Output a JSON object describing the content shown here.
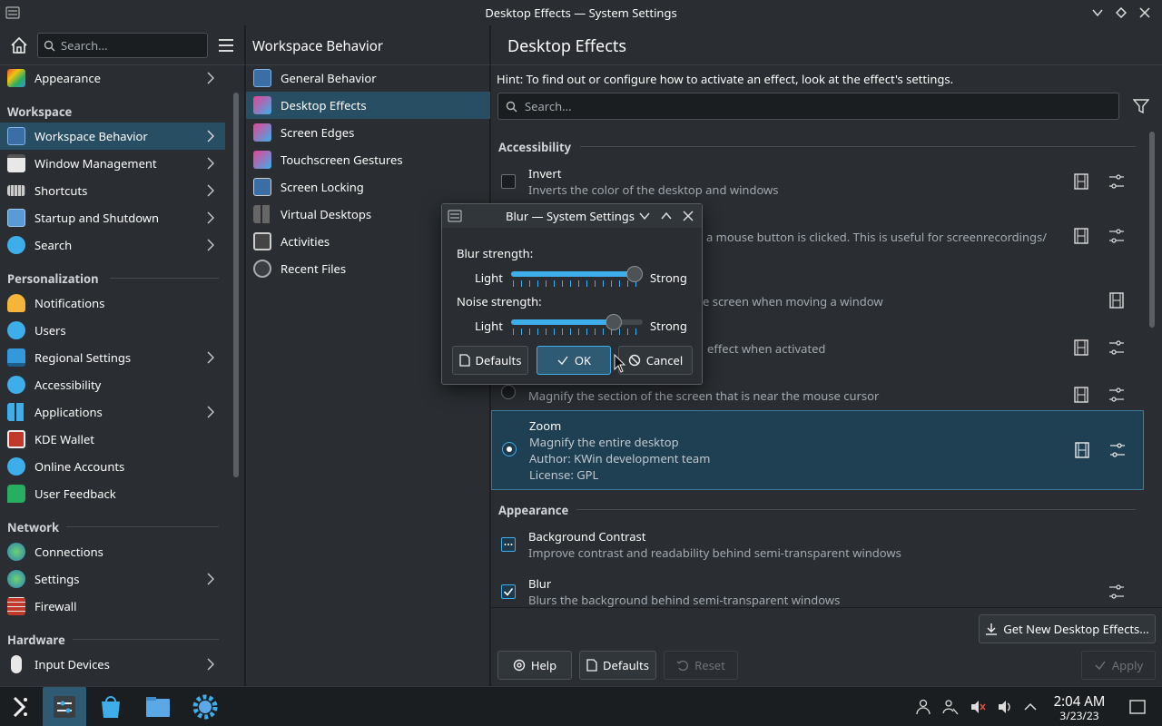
{
  "window": {
    "title": "Desktop Effects — System Settings"
  },
  "sidebar": {
    "search_placeholder": "Search...",
    "top_item": {
      "label": "Appearance"
    },
    "sections": [
      {
        "header": "Workspace",
        "items": [
          "Workspace Behavior",
          "Window Management",
          "Shortcuts",
          "Startup and Shutdown",
          "Search"
        ]
      },
      {
        "header": "Personalization",
        "items": [
          "Notifications",
          "Users",
          "Regional Settings",
          "Accessibility",
          "Applications",
          "KDE Wallet",
          "Online Accounts",
          "User Feedback"
        ]
      },
      {
        "header": "Network",
        "items": [
          "Connections",
          "Settings",
          "Firewall"
        ]
      },
      {
        "header": "Hardware",
        "items": [
          "Input Devices"
        ]
      }
    ]
  },
  "subpanel": {
    "title": "Workspace Behavior",
    "items": [
      "General Behavior",
      "Desktop Effects",
      "Screen Edges",
      "Touchscreen Gestures",
      "Screen Locking",
      "Virtual Desktops",
      "Activities",
      "Recent Files"
    ]
  },
  "main": {
    "title": "Desktop Effects",
    "hint": "Hint: To find out or configure how to activate an effect, look at the effect's settings.",
    "search_placeholder": "Search...",
    "categories": {
      "accessibility": "Accessibility",
      "appearance": "Appearance"
    },
    "effects": {
      "invert": {
        "title": "Invert",
        "desc": "Inverts the color of the desktop and windows"
      },
      "mouseclick": {
        "desc": "a mouse button is clicked. This is useful for screenrecordings/"
      },
      "trackmouse": {
        "desc": "e screen when moving a window"
      },
      "markmouse": {
        "desc": "effect when activated"
      },
      "magnifier": {
        "desc": "Magnify the section of the screen that is near the mouse cursor"
      },
      "zoom": {
        "title": "Zoom",
        "desc": "Magnify the entire desktop",
        "author": "Author: KWin development team",
        "license": "License: GPL"
      },
      "contrast": {
        "title": "Background Contrast",
        "desc": "Improve contrast and readability behind semi-transparent windows"
      },
      "blur": {
        "title": "Blur",
        "desc": "Blurs the background behind semi-transparent windows"
      }
    },
    "get_new": "Get New Desktop Effects...",
    "buttons": {
      "help": "Help",
      "defaults": "Defaults",
      "reset": "Reset",
      "apply": "Apply"
    }
  },
  "dialog": {
    "title": "Blur — System Settings",
    "blur_label": "Blur strength:",
    "noise_label": "Noise strength:",
    "light": "Light",
    "strong": "Strong",
    "blur_value": 1.0,
    "noise_value": 0.82,
    "defaults": "Defaults",
    "ok": "OK",
    "cancel": "Cancel"
  },
  "taskbar": {
    "time": "2:04 AM",
    "date": "3/23/23"
  },
  "colors": {
    "accent": "#3daee9",
    "selection": "#284e63",
    "background": "#2a2e32"
  }
}
